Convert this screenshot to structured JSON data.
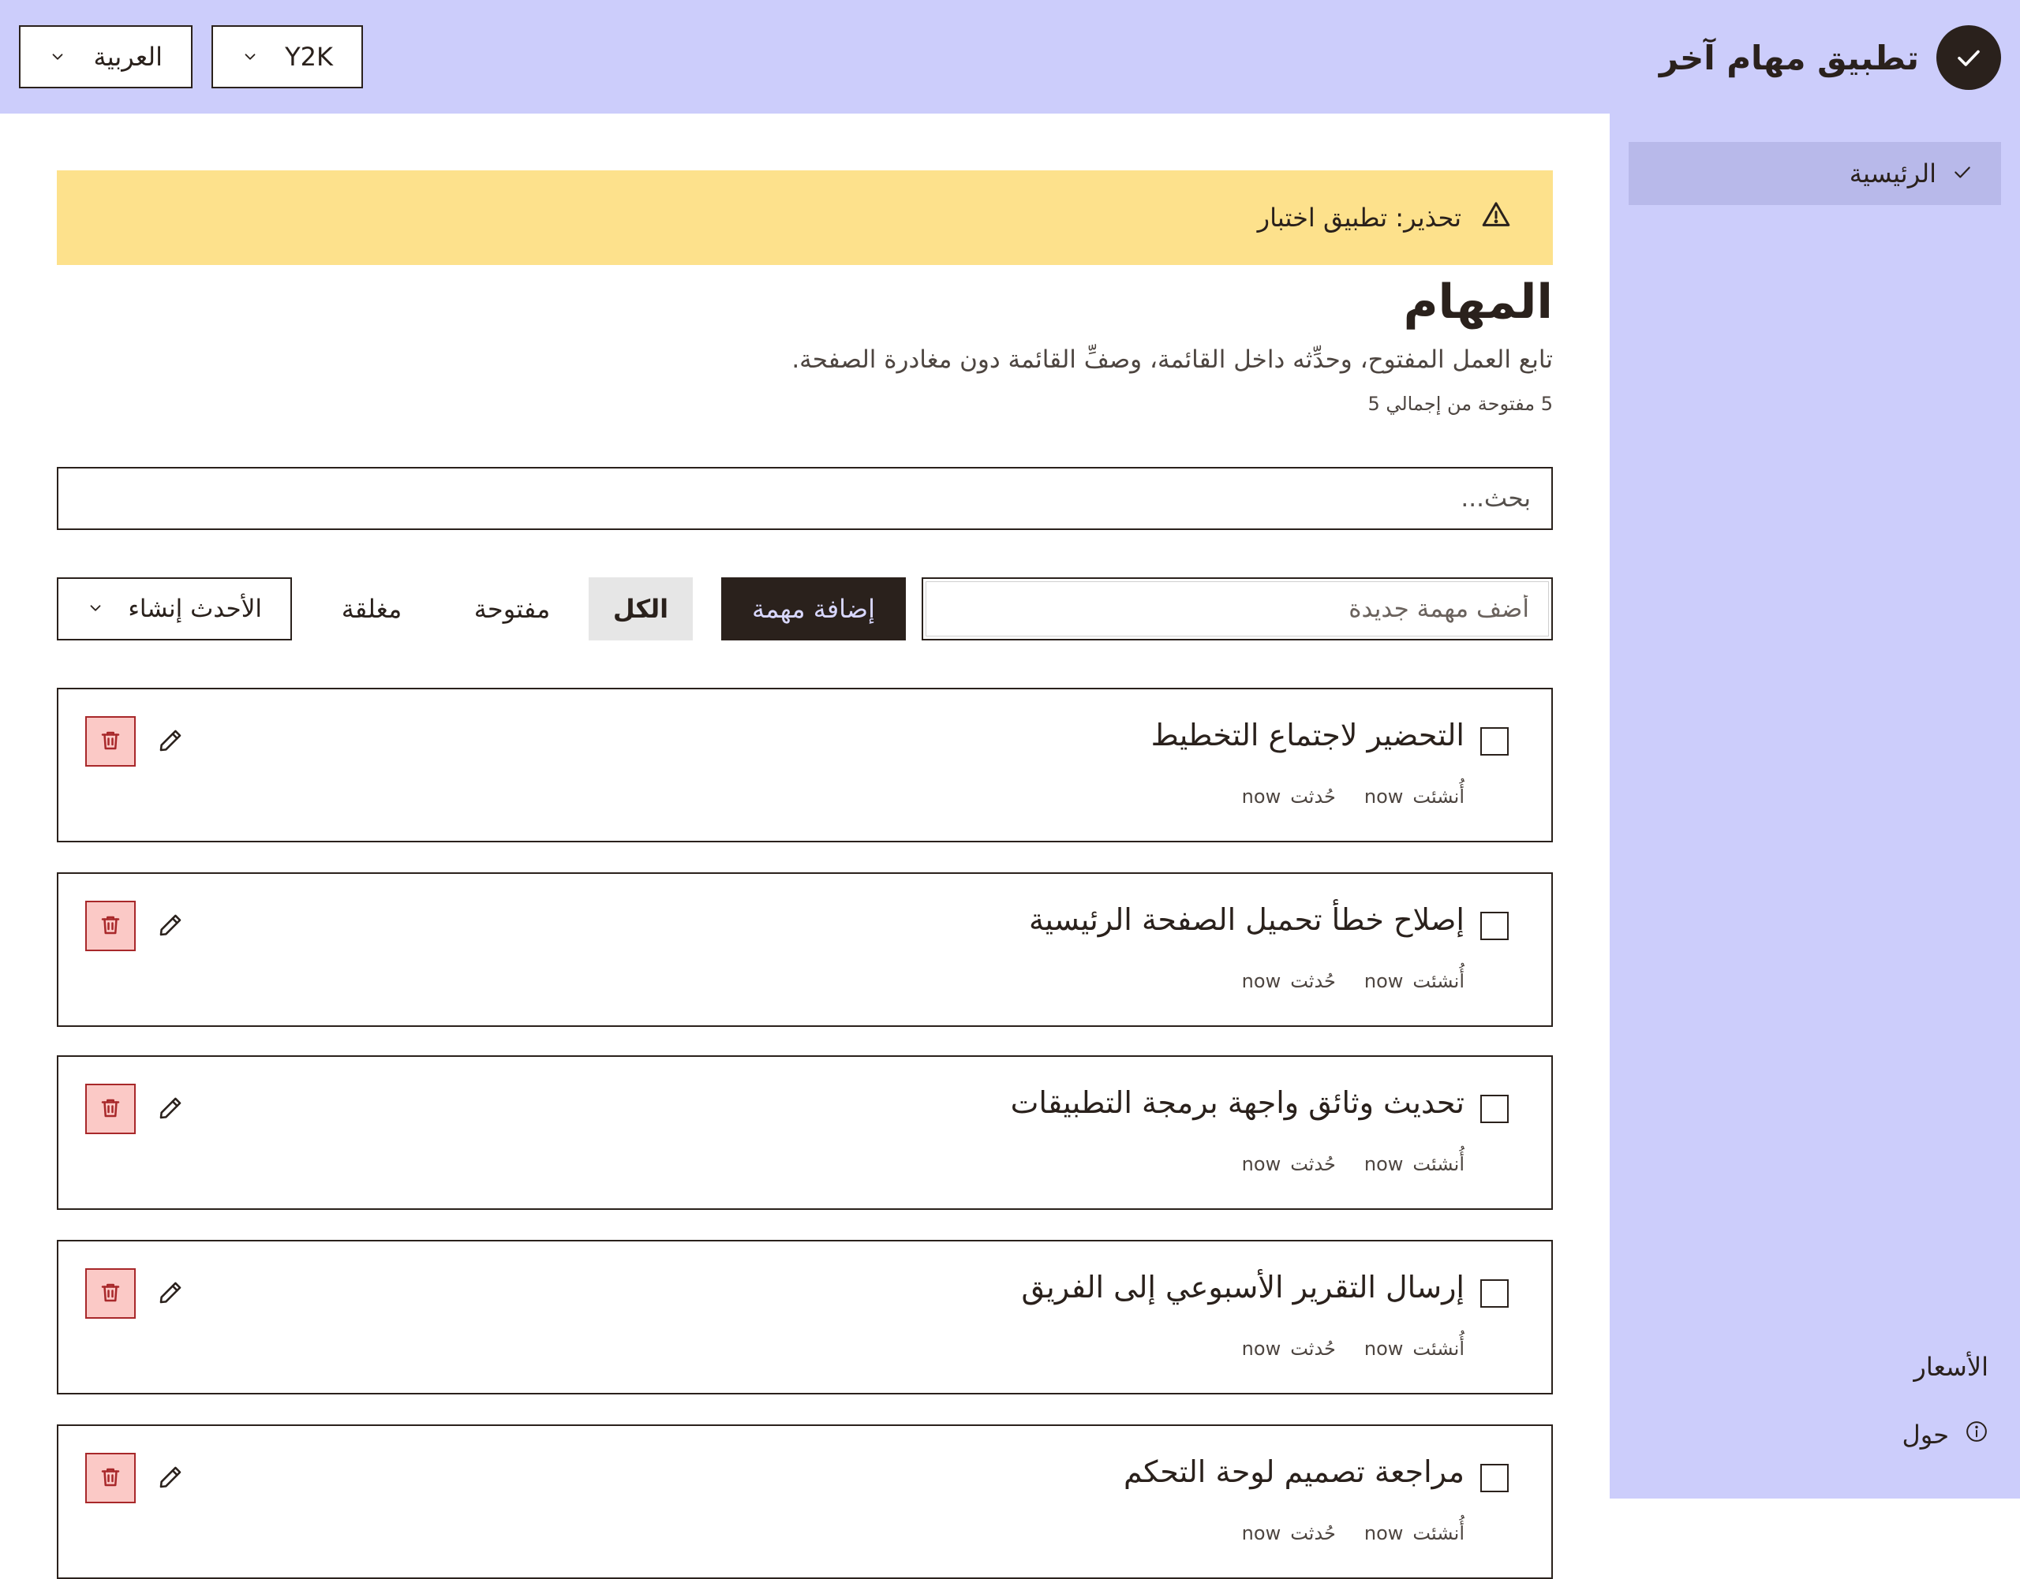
{
  "app": {
    "title": "تطبيق مهام آخر",
    "language": "العربية",
    "theme": "Y2K"
  },
  "sidebar": {
    "home": "الرئيسية",
    "pricing": "الأسعار",
    "about": "حول"
  },
  "warning": {
    "text": "تحذير: تطبيق اختبار"
  },
  "page": {
    "title": "المهام",
    "description": "تابع العمل المفتوح، وحدِّثه داخل القائمة، وصفِّ القائمة دون مغادرة الصفحة.",
    "count": "5 مفتوحة من إجمالي 5"
  },
  "search": {
    "placeholder": "بحث..."
  },
  "add": {
    "placeholder": "أضف مهمة جديدة",
    "button": "إضافة مهمة"
  },
  "filters": {
    "all": "الكل",
    "open": "مفتوحة",
    "closed": "مغلقة"
  },
  "sort": {
    "selected": "الأحدث إنشاء"
  },
  "tasks": [
    {
      "title": "التحضير لاجتماع التخطيط",
      "created_label": "أُنشئت",
      "created": "now",
      "updated_label": "حُدثت",
      "updated": "now"
    },
    {
      "title": "إصلاح خطأ تحميل الصفحة الرئيسية",
      "created_label": "أُنشئت",
      "created": "now",
      "updated_label": "حُدثت",
      "updated": "now"
    },
    {
      "title": "تحديث وثائق واجهة برمجة التطبيقات",
      "created_label": "أُنشئت",
      "created": "now",
      "updated_label": "حُدثت",
      "updated": "now"
    },
    {
      "title": "إرسال التقرير الأسبوعي إلى الفريق",
      "created_label": "أُنشئت",
      "created": "now",
      "updated_label": "حُدثت",
      "updated": "now"
    },
    {
      "title": "مراجعة تصميم لوحة التحكم",
      "created_label": "أُنشئت",
      "created": "now",
      "updated_label": "حُدثت",
      "updated": "now"
    }
  ],
  "colors": {
    "accent": "#cccdfb",
    "dark": "#2a211c",
    "warning": "#fde18c",
    "danger": "#a8282a"
  }
}
